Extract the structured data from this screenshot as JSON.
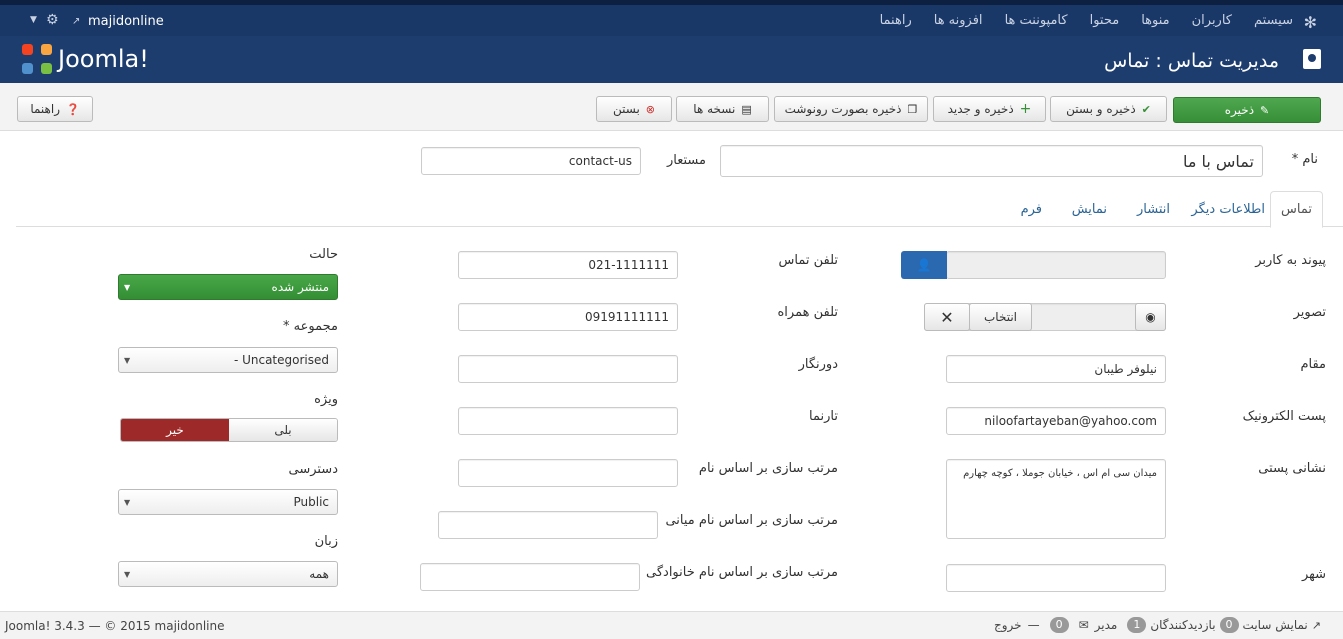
{
  "topbar": {
    "site_name": "majidonline",
    "nav": [
      "سیستم",
      "کاربران",
      "منوها",
      "محتوا",
      "کامپوننت ها",
      "افزونه ها",
      "راهنما"
    ]
  },
  "header": {
    "logo_text": "Joomla!",
    "title": "مدیریت تماس : تماس"
  },
  "toolbar": {
    "save": "ذخیره",
    "save_close": "ذخیره و بستن",
    "save_new": "ذخیره و جدید",
    "save_copy": "ذخیره بصورت رونوشت",
    "versions": "نسخه ها",
    "close": "بستن",
    "help": "راهنما"
  },
  "title_row": {
    "name_label": "نام *",
    "name_value": "تماس با ما",
    "alias_label": "مستعار",
    "alias_value": "contact-us"
  },
  "tabs": [
    "تماس",
    "اطلاعات دیگر",
    "انتشار",
    "نمایش",
    "فرم"
  ],
  "contact": {
    "link_user_label": "پیوند به کاربر",
    "image_label": "تصویر",
    "image_select": "انتخاب",
    "position_label": "مقام",
    "position_value": "نیلوفر طیبان",
    "email_label": "پست الکترونیک",
    "email_value": "niloofartayeban@yahoo.com",
    "address_label": "نشانی پستی",
    "address_value": "میدان سی ام اس ، خیابان جوملا ، کوچه چهارم",
    "city_label": "شهر",
    "phone_label": "تلفن تماس",
    "phone_value": "021-1111111",
    "mobile_label": "تلفن همراه",
    "mobile_value": "09191111111",
    "fax_label": "دورنگار",
    "web_label": "تارنما",
    "sort1_label": "مرتب سازی بر اساس نام",
    "sort2_label": "مرتب سازی بر اساس نام میانی",
    "sort3_label": "مرتب سازی بر اساس نام خانوادگی"
  },
  "sidebar": {
    "status_label": "حالت",
    "status_value": "منتشر شده",
    "category_label": "مجموعه *",
    "category_value": "- Uncategorised",
    "featured_label": "ویژه",
    "featured_yes": "بلی",
    "featured_no": "خیر",
    "access_label": "دسترسی",
    "access_value": "Public",
    "language_label": "زبان",
    "language_value": "همه"
  },
  "footer": {
    "copyright": "Joomla! 3.4.3 — © 2015 majidonline",
    "view_site": "نمایش سایت",
    "visitors_count": "0",
    "visitors_label": "بازدیدکنندگان",
    "admins_count": "1",
    "admins_label": "مدیر",
    "messages_count": "0",
    "logout": "خروج"
  },
  "colors": {
    "topbar": "#1a3867",
    "header": "#1c3d6e",
    "save_green": "#409b40",
    "status_green": "#3d9a3d",
    "featured_no": "#9d2a28",
    "user_btn": "#2a68b0"
  }
}
